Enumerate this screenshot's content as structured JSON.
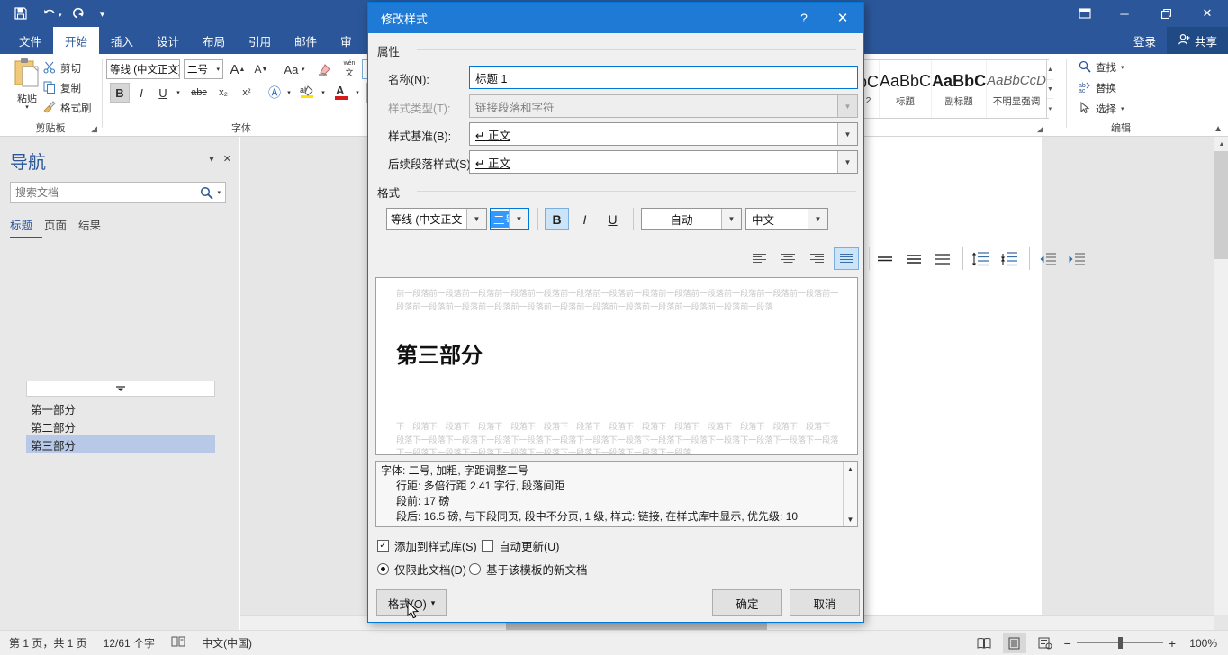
{
  "window": {
    "quick_access": [
      {
        "name": "save-icon",
        "glyph": "⬜"
      },
      {
        "name": "undo-icon",
        "glyph": "↶"
      },
      {
        "name": "redo-icon",
        "glyph": "↻"
      },
      {
        "name": "customize-qat-icon",
        "glyph": "⌄"
      }
    ],
    "ribbon_display_icon": "⬚",
    "minimize": "─",
    "maximize": "❐",
    "close": "✕"
  },
  "ribbon": {
    "tabs": [
      {
        "label": "文件",
        "active": false
      },
      {
        "label": "开始",
        "active": true
      },
      {
        "label": "插入",
        "active": false
      },
      {
        "label": "设计",
        "active": false
      },
      {
        "label": "布局",
        "active": false
      },
      {
        "label": "引用",
        "active": false
      },
      {
        "label": "邮件",
        "active": false
      },
      {
        "label": "审",
        "active": false
      }
    ],
    "signin_label": "登录",
    "share_label": "共享",
    "clipboard": {
      "group_label": "剪贴板",
      "paste_label": "粘贴",
      "cut_label": "剪切",
      "copy_label": "复制",
      "format_painter_label": "格式刷"
    },
    "font": {
      "group_label": "字体",
      "font_name": "等线 (中文正文)",
      "font_size": "二号",
      "grow_font": "A",
      "shrink_font": "A",
      "change_case": "Aa",
      "clear_format": "✐",
      "phonetic": "文",
      "bold": "B",
      "italic": "I",
      "underline": "U",
      "strikethrough": "abc",
      "subscript": "x₂",
      "superscript": "x²",
      "text_effects": "A",
      "highlight": "ab",
      "font_color": "A",
      "char_shading": "A",
      "char_border": "A"
    },
    "styles": {
      "partial_label": "2",
      "cells": [
        {
          "preview": "bC",
          "name": "2",
          "partial": true
        },
        {
          "preview": "AaBbC",
          "name": "标题",
          "partial": false
        },
        {
          "preview": "AaBbC",
          "name": "副标题",
          "partial": false
        },
        {
          "preview": "AaBbCcD",
          "name": "不明显强调",
          "partial": false
        }
      ]
    },
    "editing": {
      "group_label": "编辑",
      "find_label": "查找",
      "replace_label": "替换",
      "select_label": "选择"
    }
  },
  "navigation": {
    "title": "导航",
    "search_placeholder": "搜索文档",
    "search_value": "",
    "search_icon": "search-icon",
    "tabs": [
      {
        "label": "标题",
        "active": true
      },
      {
        "label": "页面",
        "active": false
      },
      {
        "label": "结果",
        "active": false
      }
    ],
    "headings": [
      {
        "label": "第一部分",
        "selected": false
      },
      {
        "label": "第二部分",
        "selected": false
      },
      {
        "label": "第三部分",
        "selected": true
      }
    ]
  },
  "status_bar": {
    "page_info": "第 1 页，共 1 页",
    "word_count": "12/61 个字",
    "proofing_icon": "proofing-icon",
    "language": "中文(中国)",
    "views": [
      {
        "name": "read-mode-view-button",
        "glyph": "☰",
        "active": false
      },
      {
        "name": "print-layout-view-button",
        "glyph": "≣",
        "active": true
      },
      {
        "name": "web-layout-view-button",
        "glyph": "≡",
        "active": false
      }
    ],
    "zoom_out": "−",
    "zoom_in": "+",
    "zoom_value": "100%"
  },
  "dialog": {
    "title": "修改样式",
    "help_glyph": "?",
    "close_glyph": "✕",
    "properties_section": "属性",
    "format_section": "格式",
    "fields": [
      {
        "label": "名称(N):",
        "value": "标题 1",
        "type": "text",
        "disabled": false
      },
      {
        "label": "样式类型(T):",
        "value": "链接段落和字符",
        "type": "select",
        "disabled": true
      },
      {
        "label": "样式基准(B):",
        "value": "↵ 正文",
        "type": "select",
        "disabled": false
      },
      {
        "label": "后续段落样式(S):",
        "value": "↵ 正文",
        "type": "select",
        "disabled": false
      }
    ],
    "format_bar": {
      "font_name": "等线 (中文正文",
      "font_size": "二号",
      "bold": "B",
      "italic": "I",
      "underline": "U",
      "font_color": "自动",
      "language": "中文"
    },
    "align_icons": [
      {
        "name": "align-left-icon",
        "on": false
      },
      {
        "name": "align-center-icon",
        "on": false
      },
      {
        "name": "align-right-icon",
        "on": false
      },
      {
        "name": "align-justify-icon",
        "on": true
      }
    ],
    "spacing_icons": [
      {
        "name": "line-spacing-1-icon",
        "on": false
      },
      {
        "name": "line-spacing-1-5-icon",
        "on": false
      },
      {
        "name": "line-spacing-2-icon",
        "on": false
      }
    ],
    "para_space_icons": [
      {
        "name": "increase-paragraph-spacing-icon",
        "on": false
      },
      {
        "name": "decrease-paragraph-spacing-icon",
        "on": false
      }
    ],
    "indent_icons": [
      {
        "name": "decrease-indent-icon",
        "on": false
      },
      {
        "name": "increase-indent-icon",
        "on": false
      }
    ],
    "preview": {
      "before_text": "前一段落前一段落前一段落前一段落前一段落前一段落前一段落前一段落前一段落前一段落前一段落前一段落前一段落前一段落前一段落前一段落前一段落前一段落前一段落前一段落前一段落前一段落前一段落前一段落前一段落",
      "heading_text": "第三部分",
      "after_text": "下一段落下一段落下一段落下一段落下一段落下一段落下一段落下一段落下一段落下一段落下一段落下一段落下一段落下一段落下一段落下一段落下一段落下一段落下一段落下一段落下一段落下一段落下一段落下一段落下一段落下一段落下一段落下一段落下一段落下一段落下一段落下一段落下一段落下一段落下一段落下一段落"
    },
    "description": {
      "line1": "字体: 二号, 加粗, 字距调整二号",
      "line2": "行距: 多倍行距 2.41 字行, 段落间距",
      "line3": "段前: 17 磅",
      "line4": "段后: 16.5 磅, 与下段同页, 段中不分页, 1 级, 样式: 链接, 在样式库中显示, 优先级: 10"
    },
    "checkboxes": [
      {
        "label": "添加到样式库(S)",
        "checked": true
      },
      {
        "label": "自动更新(U)",
        "checked": false
      }
    ],
    "radios": [
      {
        "label": "仅限此文档(D)",
        "checked": true
      },
      {
        "label": "基于该模板的新文档",
        "checked": false
      }
    ],
    "buttons": {
      "format": "格式(O)",
      "format_caret": "▾",
      "ok": "确定",
      "cancel": "取消"
    }
  },
  "colors": {
    "word_blue": "#2b579a",
    "dialog_blue": "#1e7ad4",
    "nav_selection": "#b8c9e8",
    "accent_highlight": "#cce4f7"
  }
}
